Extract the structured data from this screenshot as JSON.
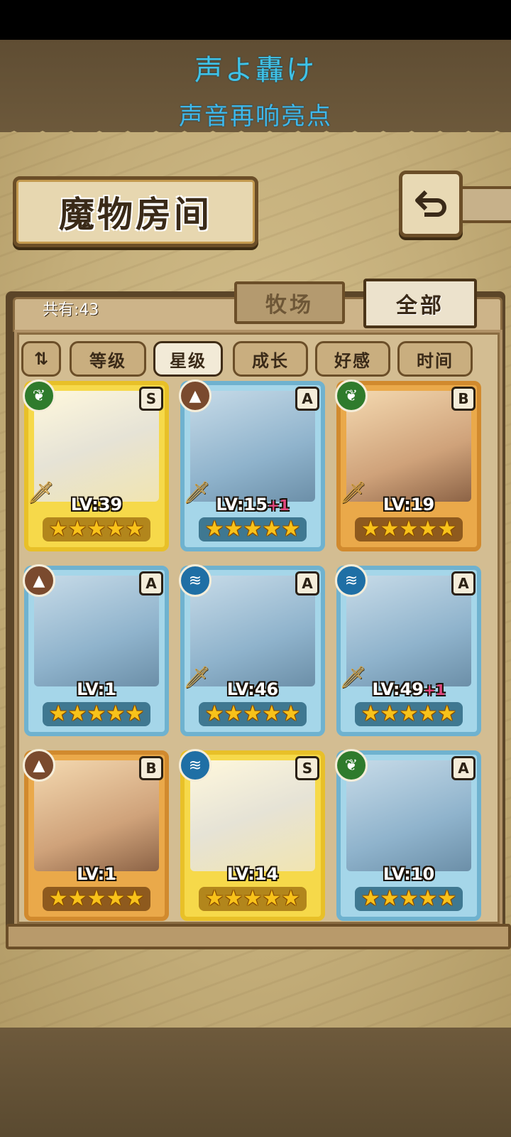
{
  "hint": {
    "line1": "声よ轟け",
    "line2": "声音再响亮点"
  },
  "header": {
    "title": "魔物房间",
    "back_icon": "return-arrow-icon"
  },
  "tabs": {
    "count_label": "共有:43",
    "ranch": "牧场",
    "all": "全部",
    "active": "全部"
  },
  "sort": {
    "toggle_label": "⇅",
    "options": [
      "等级",
      "星级",
      "成长",
      "好感",
      "时间"
    ],
    "active": "星级"
  },
  "colors": {
    "gold": "#f6d94a",
    "blue": "#a5d6e9",
    "orange": "#eaa94a",
    "hint": "#3fc3e8"
  },
  "cards": [
    {
      "frame": "gold",
      "element": "leaf",
      "rank": "S",
      "level": "LV:39",
      "plus": "",
      "stars": "★★★★★",
      "sword": true
    },
    {
      "frame": "blue",
      "element": "earth",
      "rank": "A",
      "level": "LV:15",
      "plus": "+1",
      "stars": "★★★★★",
      "sword": true
    },
    {
      "frame": "orange",
      "element": "leaf",
      "rank": "B",
      "level": "LV:19",
      "plus": "",
      "stars": "★★★★★",
      "sword": true
    },
    {
      "frame": "blue",
      "element": "earth",
      "rank": "A",
      "level": "LV:1",
      "plus": "",
      "stars": "★★★★★",
      "sword": false
    },
    {
      "frame": "blue",
      "element": "water",
      "rank": "A",
      "level": "LV:46",
      "plus": "",
      "stars": "★★★★★",
      "sword": true
    },
    {
      "frame": "blue",
      "element": "water",
      "rank": "A",
      "level": "LV:49",
      "plus": "+1",
      "stars": "★★★★★",
      "sword": true
    },
    {
      "frame": "orange",
      "element": "earth",
      "rank": "B",
      "level": "LV:1",
      "plus": "",
      "stars": "★★★★★",
      "sword": false
    },
    {
      "frame": "gold",
      "element": "water",
      "rank": "S",
      "level": "LV:14",
      "plus": "",
      "stars": "★★★★★",
      "sword": false
    },
    {
      "frame": "blue",
      "element": "leaf",
      "rank": "A",
      "level": "LV:10",
      "plus": "",
      "stars": "★★★★★",
      "sword": false
    }
  ]
}
